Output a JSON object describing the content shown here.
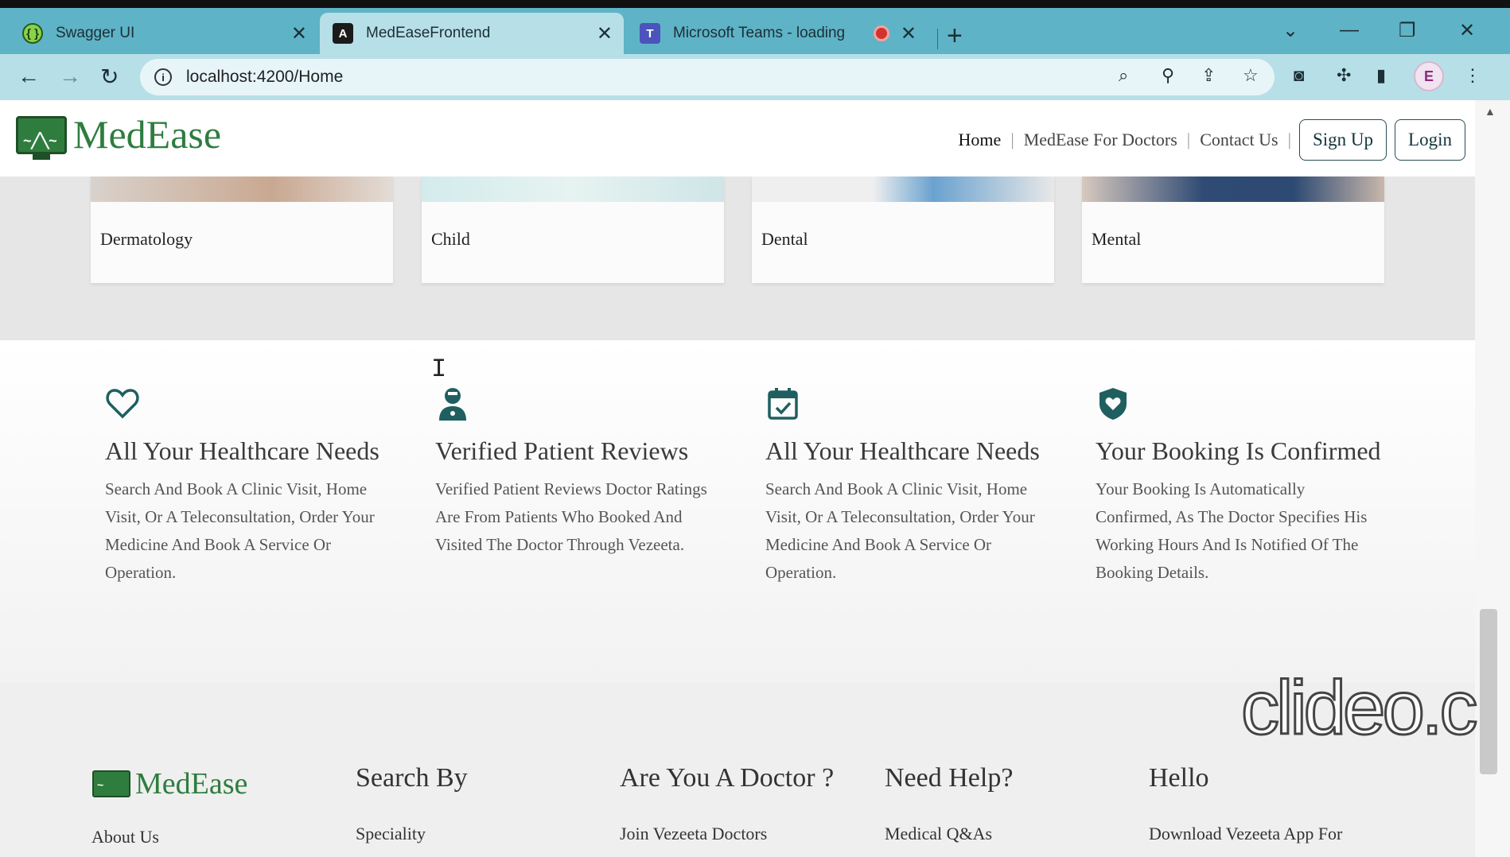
{
  "browser": {
    "tabs": [
      {
        "label": "Swagger UI",
        "icon": "swagger-icon",
        "active": false
      },
      {
        "label": "MedEaseFrontend",
        "icon": "angular-icon",
        "active": true
      },
      {
        "label": "Microsoft Teams - loading",
        "icon": "teams-icon",
        "active": false,
        "recording": true
      }
    ],
    "url": "localhost:4200/Home"
  },
  "site": {
    "brand": "MedEase",
    "nav": {
      "home": "Home",
      "doctors": "MedEase For Doctors",
      "contact": "Contact Us",
      "signup": "Sign Up",
      "login": "Login"
    },
    "specialties": [
      "Dermatology",
      "Child",
      "Dental",
      "Mental"
    ],
    "features": [
      {
        "icon": "heart-icon",
        "title": "All Your Healthcare Needs",
        "text": "Search And Book A Clinic Visit, Home Visit, Or A Teleconsultation, Order Your Medicine And Book A Service Or Operation."
      },
      {
        "icon": "doctor-icon",
        "title": "Verified Patient Reviews",
        "text": "Verified Patient Reviews Doctor Ratings Are From Patients Who Booked And Visited The Doctor Through Vezeeta."
      },
      {
        "icon": "calendar-check-icon",
        "title": "All Your Healthcare Needs",
        "text": "Search And Book A Clinic Visit, Home Visit, Or A Teleconsultation, Order Your Medicine And Book A Service Or Operation."
      },
      {
        "icon": "shield-heart-icon",
        "title": "Your Booking Is Confirmed",
        "text": "Your Booking Is Automatically Confirmed, As The Doctor Specifies His Working Hours And Is Notified Of The Booking Details."
      }
    ],
    "footer": {
      "about": "About Us",
      "columns": [
        {
          "heading": "Search By",
          "link": "Speciality"
        },
        {
          "heading": "Are You A Doctor ?",
          "link": "Join Vezeeta Doctors"
        },
        {
          "heading": "Need Help?",
          "link": "Medical Q&As"
        },
        {
          "heading": "Hello",
          "link": "Download Vezeeta App For"
        }
      ]
    }
  },
  "watermark": "clideo.c",
  "colors": {
    "brand_green": "#2e7d3f",
    "icon_teal": "#1f5f5f",
    "tab_bar": "#5fb3c6",
    "active_tab": "#b7dfe7"
  }
}
